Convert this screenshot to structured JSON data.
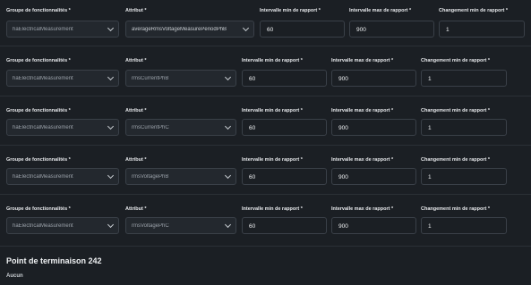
{
  "labels": {
    "cluster": "Groupe de fonctionnalités *",
    "attribute": "Attribut *",
    "min_interval": "Intervalle min de rapport *",
    "max_interval": "Intervalle max de rapport *",
    "min_change": "Changement min de rapport *"
  },
  "rows": [
    {
      "cluster": "haElectricalMeasurement",
      "attribute": "averageRmsVoltageMeasurePeriodPhB",
      "min": "60",
      "max": "900",
      "change": "1"
    },
    {
      "cluster": "haElectricalMeasurement",
      "attribute": "rmsCurrentPhB",
      "min": "60",
      "max": "900",
      "change": "1"
    },
    {
      "cluster": "haElectricalMeasurement",
      "attribute": "rmsCurrentPhC",
      "min": "60",
      "max": "900",
      "change": "1"
    },
    {
      "cluster": "haElectricalMeasurement",
      "attribute": "rmsVoltagePhB",
      "min": "60",
      "max": "900",
      "change": "1"
    },
    {
      "cluster": "haElectricalMeasurement",
      "attribute": "rmsVoltagePhC",
      "min": "60",
      "max": "900",
      "change": "1"
    }
  ],
  "endpoint": {
    "title": "Point de terminaison 242",
    "subtitle": "Aucun"
  }
}
